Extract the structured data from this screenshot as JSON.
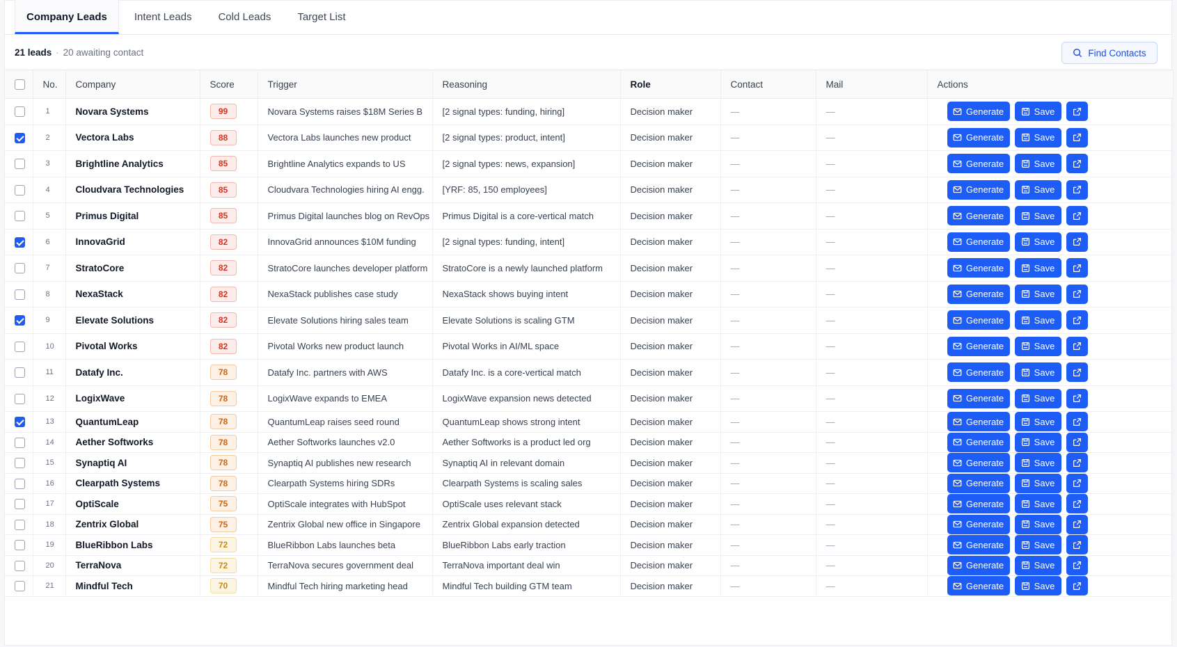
{
  "tabs": [
    "Company Leads",
    "Intent Leads",
    "Cold Leads",
    "Target List"
  ],
  "summary": {
    "count": "21 leads",
    "separator": "·",
    "awaiting": "20 awaiting contact"
  },
  "find_contacts_label": "Find Contacts",
  "columns": [
    "No.",
    "Company",
    "Score",
    "Trigger",
    "Reasoning",
    "Role",
    "Contact",
    "Mail",
    "Actions"
  ],
  "buttons": {
    "generate": "Generate",
    "save": "Save"
  },
  "colors": {
    "accent": "#1d5cf5",
    "score_high": "#d9301f",
    "score_mid": "#d4620e",
    "score_low": "#c98a0c"
  },
  "rows": [
    {
      "no": "1",
      "checked": false,
      "company": "Novara Systems",
      "score": 99,
      "trigger": "Novara Systems raises $18M Series B",
      "reasoning": "[2 signal types: funding, hiring]",
      "role": "Decision maker",
      "contact": "—",
      "mail": "—"
    },
    {
      "no": "2",
      "checked": true,
      "company": "Vectora Labs",
      "score": 88,
      "trigger": "Vectora Labs launches new product",
      "reasoning": "[2 signal types: product, intent]",
      "role": "Decision maker",
      "contact": "—",
      "mail": "—"
    },
    {
      "no": "3",
      "checked": false,
      "company": "Brightline Analytics",
      "score": 85,
      "trigger": "Brightline Analytics expands to US",
      "reasoning": "[2 signal types: news, expansion]",
      "role": "Decision maker",
      "contact": "—",
      "mail": "—"
    },
    {
      "no": "4",
      "checked": false,
      "company": "Cloudvara Technologies",
      "score": 85,
      "trigger": "Cloudvara Technologies hiring AI engg.",
      "reasoning": "[YRF: 85, 150 employees]",
      "role": "Decision maker",
      "contact": "—",
      "mail": "—"
    },
    {
      "no": "5",
      "checked": false,
      "company": "Primus Digital",
      "score": 85,
      "trigger": "Primus Digital launches blog on RevOps",
      "reasoning": "Primus Digital is a core-vertical match",
      "role": "Decision maker",
      "contact": "—",
      "mail": "—"
    },
    {
      "no": "6",
      "checked": true,
      "company": "InnovaGrid",
      "score": 82,
      "trigger": "InnovaGrid announces $10M funding",
      "reasoning": "[2 signal types: funding, intent]",
      "role": "Decision maker",
      "contact": "—",
      "mail": "—"
    },
    {
      "no": "7",
      "checked": false,
      "company": "StratoCore",
      "score": 82,
      "trigger": "StratoCore launches developer platform",
      "reasoning": "StratoCore is a newly launched platform",
      "role": "Decision maker",
      "contact": "—",
      "mail": "—"
    },
    {
      "no": "8",
      "checked": false,
      "company": "NexaStack",
      "score": 82,
      "trigger": "NexaStack publishes case study",
      "reasoning": "NexaStack shows buying intent",
      "role": "Decision maker",
      "contact": "—",
      "mail": "—"
    },
    {
      "no": "9",
      "checked": true,
      "company": "Elevate Solutions",
      "score": 82,
      "trigger": "Elevate Solutions hiring sales team",
      "reasoning": "Elevate Solutions is scaling GTM",
      "role": "Decision maker",
      "contact": "—",
      "mail": "—"
    },
    {
      "no": "10",
      "checked": false,
      "company": "Pivotal Works",
      "score": 82,
      "trigger": "Pivotal Works new product launch",
      "reasoning": "Pivotal Works in AI/ML space",
      "role": "Decision maker",
      "contact": "—",
      "mail": "—"
    },
    {
      "no": "11",
      "checked": false,
      "company": "Datafy Inc.",
      "score": 78,
      "trigger": "Datafy Inc. partners with AWS",
      "reasoning": "Datafy Inc. is a core-vertical match",
      "role": "Decision maker",
      "contact": "—",
      "mail": "—"
    },
    {
      "no": "12",
      "checked": false,
      "company": "LogixWave",
      "score": 78,
      "trigger": "LogixWave expands to EMEA",
      "reasoning": "LogixWave expansion news detected",
      "role": "Decision maker",
      "contact": "—",
      "mail": "—"
    },
    {
      "no": "13",
      "checked": true,
      "company": "QuantumLeap",
      "score": 78,
      "trigger": "QuantumLeap raises seed round",
      "reasoning": "QuantumLeap shows strong intent",
      "role": "Decision maker",
      "contact": "—",
      "mail": "—"
    },
    {
      "no": "14",
      "checked": false,
      "company": "Aether Softworks",
      "score": 78,
      "trigger": "Aether Softworks launches v2.0",
      "reasoning": "Aether Softworks is a product led org",
      "role": "Decision maker",
      "contact": "—",
      "mail": "—"
    },
    {
      "no": "15",
      "checked": false,
      "company": "Synaptiq AI",
      "score": 78,
      "trigger": "Synaptiq AI publishes new research",
      "reasoning": "Synaptiq AI in relevant domain",
      "role": "Decision maker",
      "contact": "—",
      "mail": "—"
    },
    {
      "no": "16",
      "checked": false,
      "company": "Clearpath Systems",
      "score": 78,
      "trigger": "Clearpath Systems hiring SDRs",
      "reasoning": "Clearpath Systems is scaling sales",
      "role": "Decision maker",
      "contact": "—",
      "mail": "—"
    },
    {
      "no": "17",
      "checked": false,
      "company": "OptiScale",
      "score": 75,
      "trigger": "OptiScale integrates with HubSpot",
      "reasoning": "OptiScale uses relevant stack",
      "role": "Decision maker",
      "contact": "—",
      "mail": "—"
    },
    {
      "no": "18",
      "checked": false,
      "company": "Zentrix Global",
      "score": 75,
      "trigger": "Zentrix Global new office in Singapore",
      "reasoning": "Zentrix Global expansion detected",
      "role": "Decision maker",
      "contact": "—",
      "mail": "—"
    },
    {
      "no": "19",
      "checked": false,
      "company": "BlueRibbon Labs",
      "score": 72,
      "trigger": "BlueRibbon Labs launches beta",
      "reasoning": "BlueRibbon Labs early traction",
      "role": "Decision maker",
      "contact": "—",
      "mail": "—"
    },
    {
      "no": "20",
      "checked": false,
      "company": "TerraNova",
      "score": 72,
      "trigger": "TerraNova secures government deal",
      "reasoning": "TerraNova important deal win",
      "role": "Decision maker",
      "contact": "—",
      "mail": "—"
    },
    {
      "no": "21",
      "checked": false,
      "company": "Mindful Tech",
      "score": 70,
      "trigger": "Mindful Tech hiring marketing head",
      "reasoning": "Mindful Tech building GTM team",
      "role": "Decision maker",
      "contact": "—",
      "mail": "—"
    }
  ]
}
